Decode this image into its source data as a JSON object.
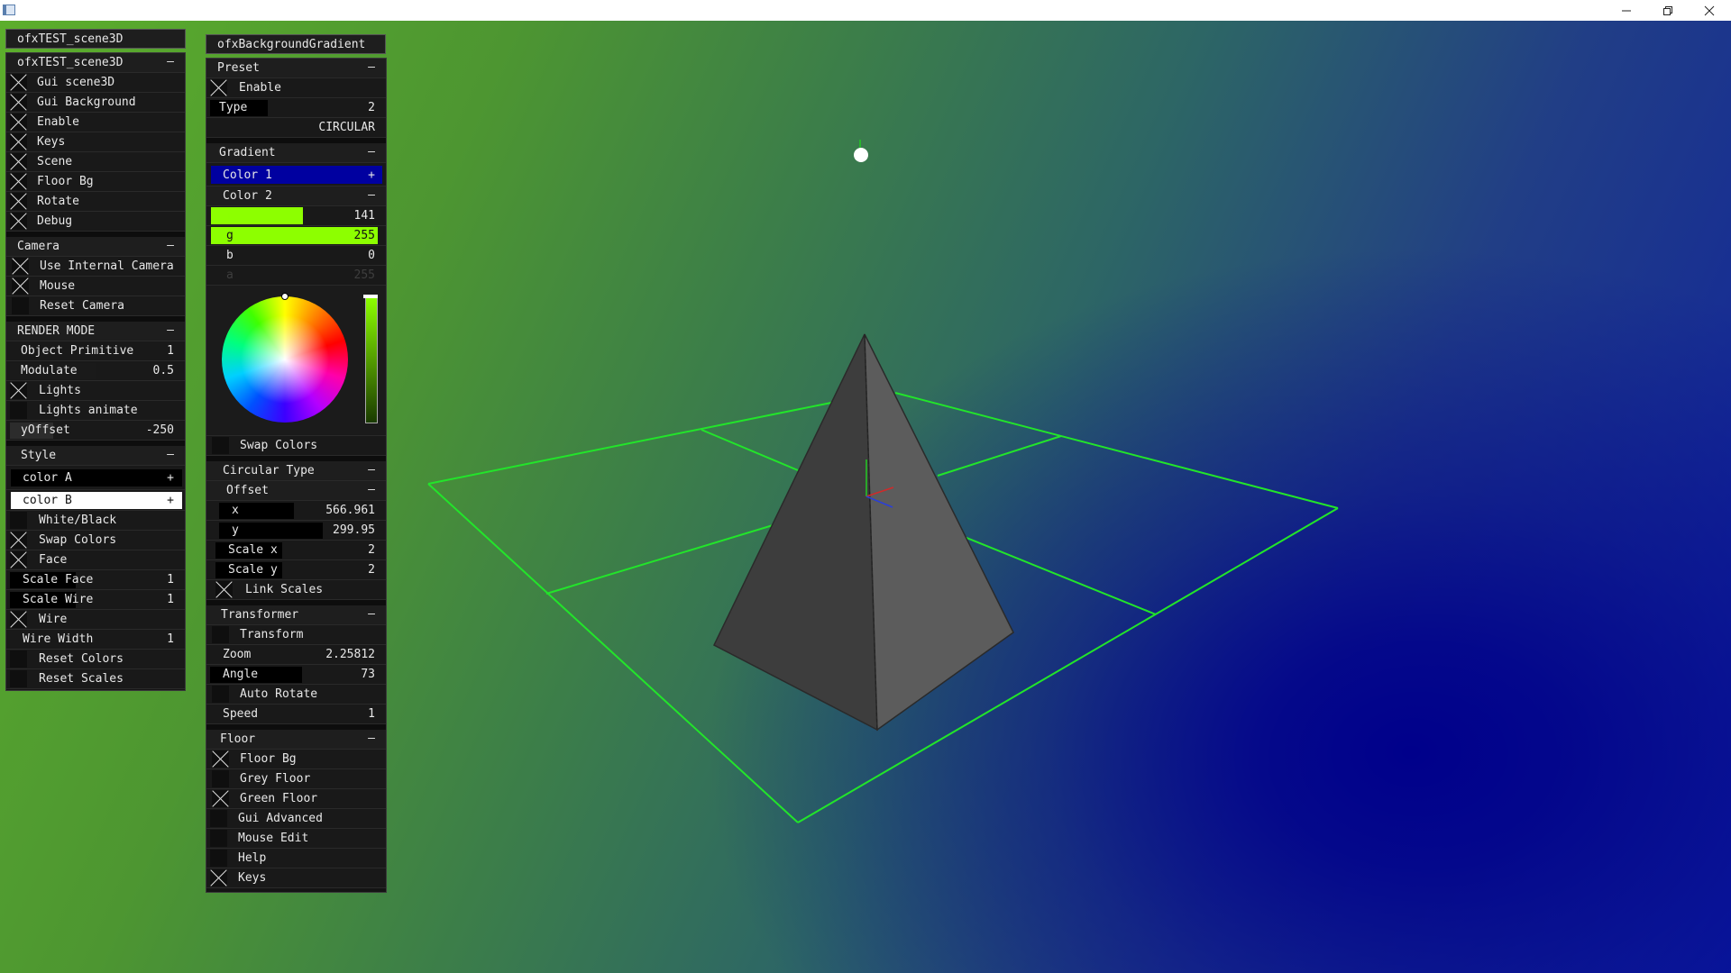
{
  "window": {
    "icons": {
      "app": "app-icon",
      "minimize": "minimize-icon",
      "restore": "restore-icon",
      "close": "close-icon"
    }
  },
  "scene_panel": {
    "title": "ofxTEST_scene3D",
    "group_label": "ofxTEST_scene3D",
    "toggles": [
      {
        "label": "Gui scene3D",
        "checked": true
      },
      {
        "label": "Gui Background",
        "checked": true
      },
      {
        "label": "Enable",
        "checked": true
      },
      {
        "label": "Keys",
        "checked": true
      },
      {
        "label": "Scene",
        "checked": true
      },
      {
        "label": "Floor Bg",
        "checked": true
      },
      {
        "label": "Rotate",
        "checked": true
      },
      {
        "label": "Debug",
        "checked": true
      }
    ],
    "camera": {
      "label": "Camera",
      "items": [
        {
          "label": "Use Internal Camera",
          "checked": true
        },
        {
          "label": "Mouse",
          "checked": true
        },
        {
          "label": "Reset Camera",
          "checked": false
        }
      ]
    },
    "render": {
      "label": "RENDER MODE",
      "object_primitive": {
        "label": "Object Primitive",
        "value": "1"
      },
      "modulate": {
        "label": "Modulate",
        "value": "0.5",
        "fill": 0.5
      },
      "lights": {
        "label": "Lights",
        "checked": true
      },
      "lights_animate": {
        "label": "Lights animate",
        "checked": false
      },
      "yoffset": {
        "label": "yOffset",
        "value": "-250",
        "fill": 0.25
      }
    },
    "style": {
      "label": "Style",
      "color_a": {
        "label": "color A",
        "sign": "+"
      },
      "color_b": {
        "label": "color B",
        "sign": "+"
      },
      "white_black": {
        "label": "White/Black",
        "checked": false
      },
      "swap_colors": {
        "label": "Swap Colors",
        "checked": true
      },
      "face": {
        "label": "Face",
        "checked": true
      },
      "scale_face": {
        "label": "Scale Face",
        "value": "1",
        "fill": 0.38
      },
      "scale_wire": {
        "label": "Scale Wire",
        "value": "1",
        "fill": 0.38
      },
      "wire": {
        "label": "Wire",
        "checked": true
      },
      "wire_width": {
        "label": "Wire Width",
        "value": "1",
        "fill": 0.0
      },
      "reset_colors": {
        "label": "Reset Colors",
        "checked": false
      },
      "reset_scales": {
        "label": "Reset Scales",
        "checked": false
      }
    },
    "minus": "–"
  },
  "bg_panel": {
    "title": "ofxBackgroundGradient",
    "preset": {
      "label": "Preset",
      "enable": {
        "label": "Enable",
        "checked": true
      },
      "type": {
        "label": "Type",
        "value": "2",
        "fill": 0.33
      },
      "type_name": "CIRCULAR"
    },
    "gradient": {
      "label": "Gradient",
      "color1": {
        "label": "Color 1",
        "sign": "+",
        "color": "#0000a0"
      },
      "color2": {
        "label": "Color 2",
        "r": {
          "label": "r",
          "value": "141",
          "fill": 0.553
        },
        "g": {
          "label": "g",
          "value": "255",
          "fill": 1.0
        },
        "b": {
          "label": "b",
          "value": "0",
          "fill": 0.0
        },
        "a": {
          "label": "a",
          "value": "255"
        },
        "swatch": "#8dff00"
      },
      "swap_colors": {
        "label": "Swap Colors",
        "checked": false
      }
    },
    "circular": {
      "label": "Circular Type",
      "offset": {
        "label": "Offset",
        "x": {
          "label": "x",
          "value": "566.961",
          "fill": 0.45
        },
        "y": {
          "label": "y",
          "value": "299.95",
          "fill": 0.62
        }
      },
      "scale_x": {
        "label": "Scale x",
        "value": "2",
        "fill": 0.4
      },
      "scale_y": {
        "label": "Scale y",
        "value": "2",
        "fill": 0.4
      },
      "link_scales": {
        "label": "Link Scales",
        "checked": true
      }
    },
    "transformer": {
      "label": "Transformer",
      "transform": {
        "label": "Transform",
        "checked": false
      },
      "zoom": {
        "label": "Zoom",
        "value": "2.25812",
        "fill": 0.0
      },
      "angle": {
        "label": "Angle",
        "value": "73",
        "fill": 0.55
      },
      "auto_rotate": {
        "label": "Auto Rotate",
        "checked": false
      },
      "speed": {
        "label": "Speed",
        "value": "1",
        "fill": 0.0
      }
    },
    "floor": {
      "label": "Floor",
      "floor_bg": {
        "label": "Floor Bg",
        "checked": true
      },
      "grey_floor": {
        "label": "Grey Floor",
        "checked": false
      },
      "green_floor": {
        "label": "Green Floor",
        "checked": true
      }
    },
    "extras": [
      {
        "label": "Gui Advanced",
        "checked": false
      },
      {
        "label": "Mouse Edit",
        "checked": false
      },
      {
        "label": "Help",
        "checked": false
      },
      {
        "label": "Keys",
        "checked": true
      }
    ],
    "minus": "–"
  },
  "scene": {
    "wire_color": "#22e52a",
    "pyramid_dark": "#3a3a3a",
    "pyramid_light": "#5e5e5e",
    "light_marker": "light-point-icon",
    "axes": "axes-gizmo-icon"
  }
}
